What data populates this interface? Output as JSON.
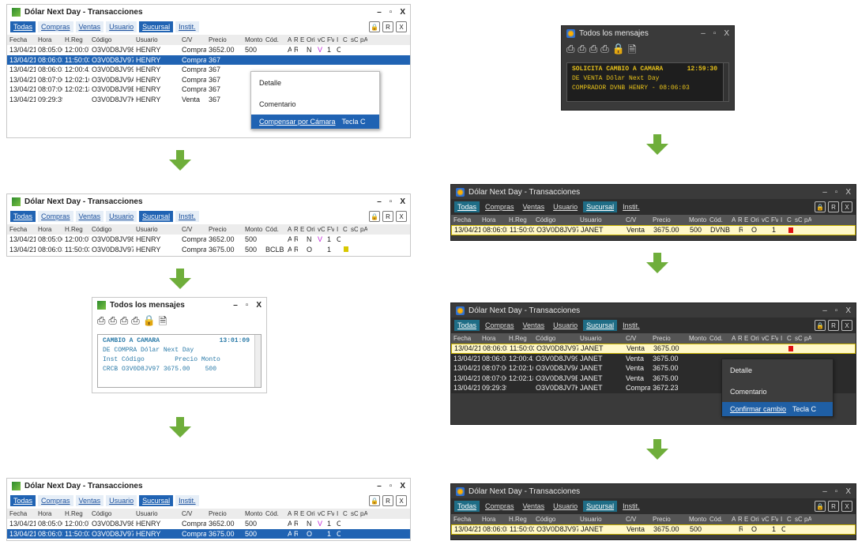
{
  "colors": {
    "arrow": "#6fae3b",
    "accent": "#2063b3",
    "highlight_yellow": "#fff8c8"
  },
  "windows": {
    "title": "Dólar Next Day - Transacciones",
    "tabs": [
      "Todas",
      "Compras",
      "Ventas",
      "Usuario",
      "Sucursal",
      "Instit."
    ],
    "toolbar_icons": [
      "lock-icon",
      "r-icon",
      "x-icon"
    ],
    "header": [
      "Fecha",
      "Hora",
      "H.Reg",
      "Código",
      "Usuario",
      "C/V",
      "Precio",
      "Monto",
      "Cód.",
      "A",
      "R",
      "E",
      "Ori",
      "vC",
      "FV",
      "I",
      "C",
      "sC",
      "pA"
    ]
  },
  "left1": {
    "rows": [
      [
        "13/04/21",
        "08:05:06",
        "12:00:07",
        "O3V0D8JV98",
        "HENRY",
        "Compra",
        "3652.00",
        "500",
        "",
        "A",
        "R",
        "",
        "N",
        "V",
        "1",
        "C"
      ],
      [
        "13/04/21",
        "08:06:03",
        "11:50:03",
        "O3V0D8JV97",
        "HENRY",
        "Compra",
        "367",
        "",
        "",
        "",
        "",
        "",
        "",
        "",
        "",
        ""
      ],
      [
        "13/04/21",
        "08:06:03",
        "12:00:42",
        "O3V0D8JV99",
        "HENRY",
        "Compra",
        "367",
        "",
        "",
        "",
        "",
        "",
        "",
        "",
        "",
        ""
      ],
      [
        "13/04/21",
        "08:07:06",
        "12:02:10",
        "O3V0D8JV9A",
        "HENRY",
        "Compra",
        "367",
        "",
        "",
        "",
        "",
        "",
        "",
        "",
        "",
        ""
      ],
      [
        "13/04/21",
        "08:07:06",
        "12:02:18",
        "O3V0D8JV9B",
        "HENRY",
        "Compra",
        "367",
        "",
        "",
        "",
        "",
        "",
        "",
        "",
        "",
        ""
      ],
      [
        "13/04/21",
        "09:29:39",
        "",
        "O3V0D8JV7K",
        "HENRY",
        "Venta",
        "367",
        "",
        "",
        "",
        "",
        "",
        "",
        "",
        "",
        ""
      ]
    ],
    "menu": [
      "Detalle",
      "Comentario",
      "Compensar por Cámara",
      "Tecla C"
    ]
  },
  "left2": {
    "rows": [
      [
        "13/04/21",
        "08:05:06",
        "12:00:07",
        "O3V0D8JV98",
        "HENRY",
        "Compra",
        "3652.00",
        "500",
        "",
        "A",
        "R",
        "",
        "N",
        "V",
        "1",
        "C"
      ],
      [
        "13/04/21",
        "08:06:03",
        "11:50:03",
        "O3V0D8JV97",
        "HENRY",
        "Compra",
        "3675.00",
        "500",
        "BCLB",
        "A",
        "R",
        "",
        "O",
        "",
        "1",
        ""
      ]
    ]
  },
  "msg_light": {
    "title": "Todos los mensajes",
    "lines": [
      "CAMBIO A CAMARA",
      "DE COMPRA Dólar Next Day",
      "Inst Código        Precio Monto",
      "CRCB O3V0D8JV97 3675.00    500"
    ],
    "time": "13:01:09"
  },
  "left3": {
    "rows": [
      [
        "13/04/21",
        "08:05:06",
        "12:00:07",
        "O3V0D8JV98",
        "HENRY",
        "Compra",
        "3652.00",
        "500",
        "",
        "A",
        "R",
        "",
        "N",
        "V",
        "1",
        "C"
      ],
      [
        "13/04/21",
        "08:06:03",
        "11:50:03",
        "O3V0D8JV97",
        "HENRY",
        "Compra",
        "3675.00",
        "500",
        "",
        "A",
        "R",
        "",
        "O",
        "",
        "1",
        "C"
      ]
    ]
  },
  "msg_dark": {
    "title": "Todos los mensajes",
    "lines": [
      "SOLICITA CAMBIO A CAMARA",
      "DE VENTA Dólar Next Day",
      "COMPRADOR DVNB HENRY - 08:06:03"
    ],
    "time": "12:59:30"
  },
  "right1": {
    "rows": [
      [
        "13/04/21",
        "08:06:03",
        "11:50:03",
        "O3V0D8JV97",
        "JANET",
        "Venta",
        "3675.00",
        "500",
        "DVNB",
        "",
        "R",
        "",
        "O",
        "",
        "1",
        ""
      ]
    ]
  },
  "right2": {
    "rows": [
      [
        "13/04/21",
        "08:06:03",
        "11:50:03",
        "O3V0D8JV97",
        "JANET",
        "Venta",
        "3675.00",
        "",
        "",
        "",
        "",
        "",
        "",
        "",
        "",
        ""
      ],
      [
        "13/04/21",
        "08:06:03",
        "12:00:42",
        "O3V0D8JV99",
        "JANET",
        "Venta",
        "3675.00",
        "",
        "",
        "",
        "",
        "",
        "",
        "",
        "",
        ""
      ],
      [
        "13/04/21",
        "08:07:06",
        "12:02:10",
        "O3V0D8JV9A",
        "JANET",
        "Venta",
        "3675.00",
        "",
        "",
        "",
        "",
        "",
        "",
        "",
        "",
        ""
      ],
      [
        "13/04/21",
        "08:07:06",
        "12:02:18",
        "O3V0D8JV9B",
        "JANET",
        "Venta",
        "3675.00",
        "",
        "",
        "",
        "",
        "",
        "",
        "",
        "",
        ""
      ],
      [
        "13/04/21",
        "09:29:39",
        "",
        "O3V0D8JV7K",
        "JANET",
        "Compra",
        "3672.23",
        "",
        "",
        "",
        "",
        "",
        "",
        "",
        "",
        ""
      ]
    ],
    "menu": [
      "Detalle",
      "Comentario",
      "Confirmar cambio",
      "Tecla C"
    ]
  },
  "right3": {
    "rows": [
      [
        "13/04/21",
        "08:06:03",
        "11:50:03",
        "O3V0D8JV97",
        "JANET",
        "Venta",
        "3675.00",
        "500",
        "",
        "",
        "R",
        "",
        "O",
        "",
        "1",
        "C"
      ]
    ]
  }
}
